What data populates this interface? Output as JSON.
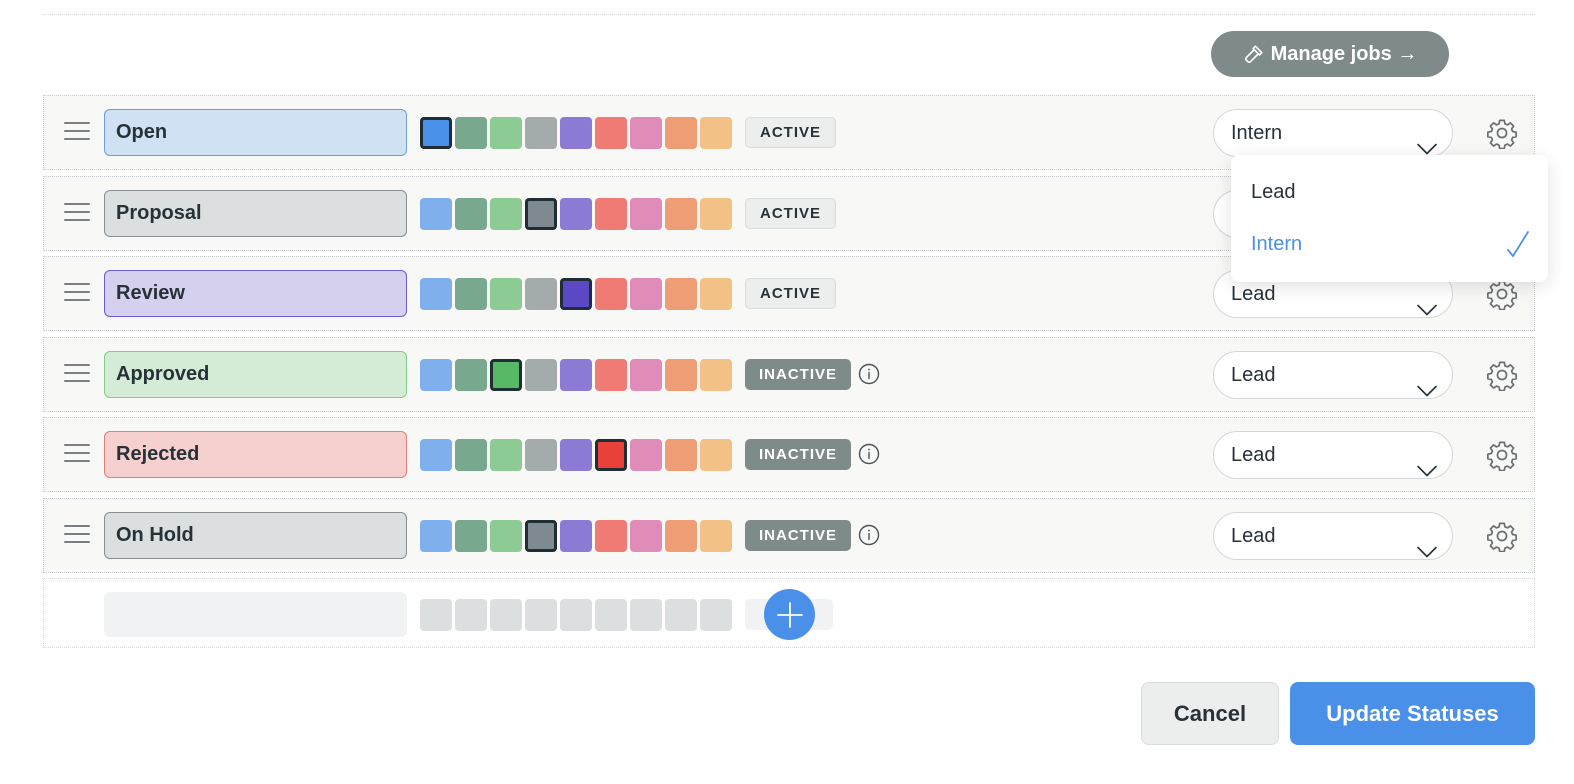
{
  "header": {
    "manage_jobs_label": "Manage jobs →",
    "manage_jobs_icon": "hammer-icon"
  },
  "palette": [
    "#7fb0ed",
    "#78a88d",
    "#8ccb93",
    "#a3abad",
    "#8d7ad4",
    "#f07b74",
    "#e08cb8",
    "#ef9d74",
    "#f2c185"
  ],
  "statuses": [
    {
      "name": "Open",
      "fill": "#cfe1f3",
      "border": "#6b9fd8",
      "selected_index": 0,
      "selected_color": "#4a90e8",
      "badge": "ACTIVE",
      "role": "Intern",
      "info": false
    },
    {
      "name": "Proposal",
      "fill": "#dcdfe0",
      "border": "#8a8f93",
      "selected_index": 3,
      "selected_color": "#7e8a90",
      "badge": "ACTIVE",
      "role": "Lead",
      "info": false
    },
    {
      "name": "Review",
      "fill": "#d5d0ee",
      "border": "#6a5ccc",
      "selected_index": 4,
      "selected_color": "#5b48c4",
      "badge": "ACTIVE",
      "role": "Lead",
      "info": false
    },
    {
      "name": "Approved",
      "fill": "#d4ecd6",
      "border": "#7fcd86",
      "selected_index": 2,
      "selected_color": "#57b866",
      "badge": "INACTIVE",
      "role": "Lead",
      "info": true
    },
    {
      "name": "Rejected",
      "fill": "#f6d0ce",
      "border": "#e07e78",
      "selected_index": 5,
      "selected_color": "#e8413a",
      "badge": "INACTIVE",
      "role": "Lead",
      "info": true
    },
    {
      "name": "On Hold",
      "fill": "#dcdfe0",
      "border": "#8a8f93",
      "selected_index": 3,
      "selected_color": "#7e8a90",
      "badge": "INACTIVE",
      "role": "Lead",
      "info": true
    }
  ],
  "role_dropdown": {
    "open_for_status": "Open",
    "options": [
      "Lead",
      "Intern"
    ],
    "selected": "Intern"
  },
  "footer": {
    "cancel_label": "Cancel",
    "update_label": "Update Statuses"
  },
  "colors": {
    "accent": "#4a90e8",
    "inactive_badge": "#7f8a8b",
    "manage_button": "#7f8a8b"
  }
}
